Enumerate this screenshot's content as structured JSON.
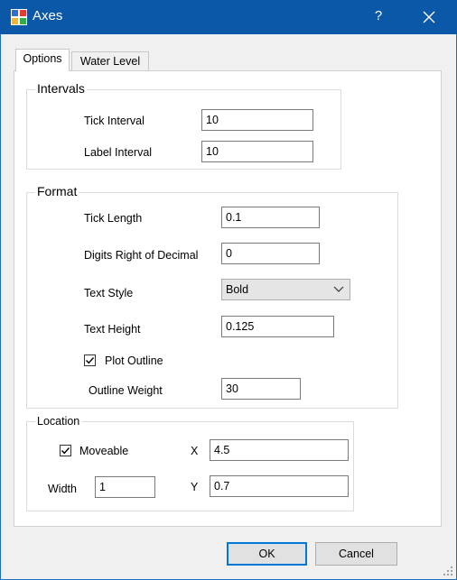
{
  "window": {
    "title": "Axes",
    "help_glyph": "?",
    "icon": "app-icon",
    "close_icon": "close-icon"
  },
  "tabs": [
    {
      "label": "Options",
      "active": true
    },
    {
      "label": "Water Level",
      "active": false
    }
  ],
  "intervals": {
    "title": "Intervals",
    "tick_interval_label": "Tick Interval",
    "tick_interval_value": "10",
    "label_interval_label": "Label Interval",
    "label_interval_value": "10"
  },
  "format": {
    "title": "Format",
    "tick_length_label": "Tick Length",
    "tick_length_value": "0.1",
    "digits_label": "Digits Right of Decimal",
    "digits_value": "0",
    "text_style_label": "Text Style",
    "text_style_value": "Bold",
    "text_height_label": "Text Height",
    "text_height_value": "0.125",
    "plot_outline_label": "Plot Outline",
    "plot_outline_checked": true,
    "outline_weight_label": "Outline Weight",
    "outline_weight_value": "30"
  },
  "location": {
    "title": "Location",
    "moveable_label": "Moveable",
    "moveable_checked": true,
    "x_label": "X",
    "x_value": "4.5",
    "width_label": "Width",
    "width_value": "1",
    "y_label": "Y",
    "y_value": "0.7"
  },
  "buttons": {
    "ok": "OK",
    "cancel": "Cancel"
  },
  "colors": {
    "titlebar": "#0b58a8",
    "accent": "#0078d7"
  }
}
